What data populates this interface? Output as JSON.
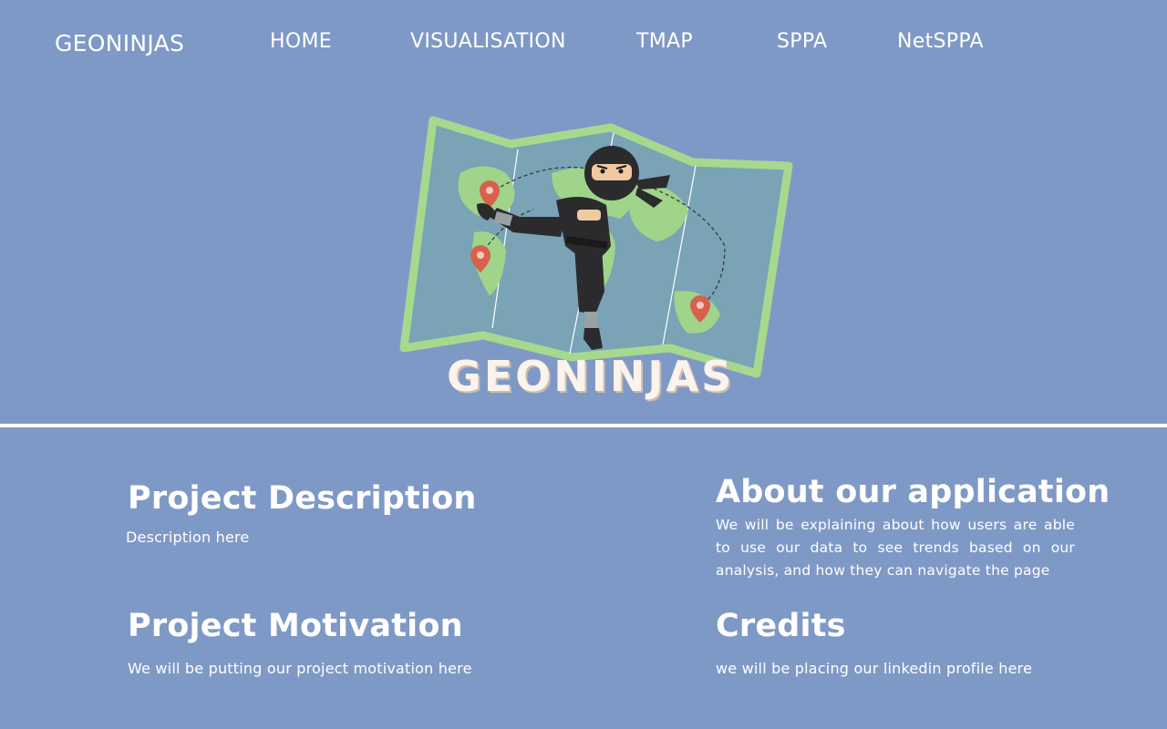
{
  "nav": {
    "brand": "GEONINJAS",
    "items": [
      {
        "label": "HOME"
      },
      {
        "label": "VISUALISATION"
      },
      {
        "label": "TMAP"
      },
      {
        "label": "SPPA"
      },
      {
        "label": "NetSPPA"
      }
    ]
  },
  "hero": {
    "logo_text": "GEONINJAS",
    "logo_icon": "ninja-map-illustration"
  },
  "sections": {
    "description": {
      "title": "Project Description",
      "body": "Description here"
    },
    "motivation": {
      "title": "Project Motivation",
      "body": "We will be putting our project motivation here"
    },
    "about": {
      "title": "About our application",
      "body": "We will be explaining about how users are able to use our data to see trends based on our analysis, and how they can navigate the page"
    },
    "credits": {
      "title": "Credits",
      "body": "we will be placing our linkedin profile here"
    }
  },
  "colors": {
    "background": "#7f99c6",
    "map_border": "#a6d98e",
    "map_water": "#7aa3b5",
    "map_land": "#9fd48a",
    "pin": "#d8614c",
    "text": "#ffffff"
  }
}
